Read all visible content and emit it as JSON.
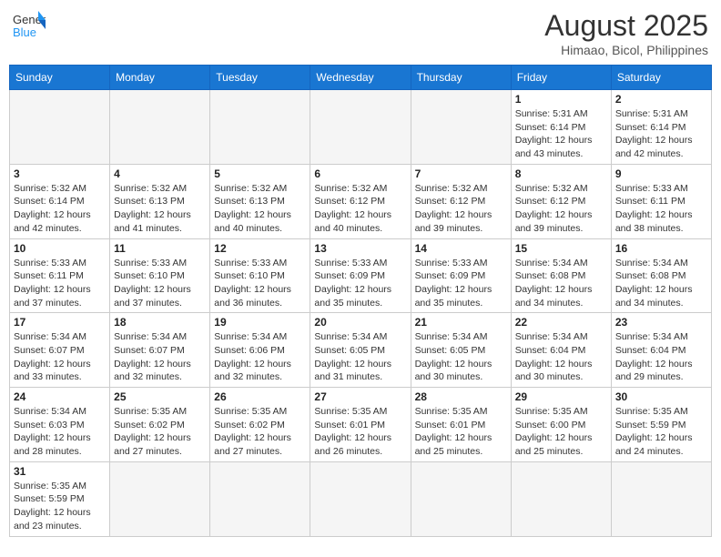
{
  "header": {
    "logo_general": "General",
    "logo_blue": "Blue",
    "month_year": "August 2025",
    "location": "Himaao, Bicol, Philippines"
  },
  "weekdays": [
    "Sunday",
    "Monday",
    "Tuesday",
    "Wednesday",
    "Thursday",
    "Friday",
    "Saturday"
  ],
  "weeks": [
    [
      {
        "day": "",
        "info": ""
      },
      {
        "day": "",
        "info": ""
      },
      {
        "day": "",
        "info": ""
      },
      {
        "day": "",
        "info": ""
      },
      {
        "day": "",
        "info": ""
      },
      {
        "day": "1",
        "info": "Sunrise: 5:31 AM\nSunset: 6:14 PM\nDaylight: 12 hours and 43 minutes."
      },
      {
        "day": "2",
        "info": "Sunrise: 5:31 AM\nSunset: 6:14 PM\nDaylight: 12 hours and 42 minutes."
      }
    ],
    [
      {
        "day": "3",
        "info": "Sunrise: 5:32 AM\nSunset: 6:14 PM\nDaylight: 12 hours and 42 minutes."
      },
      {
        "day": "4",
        "info": "Sunrise: 5:32 AM\nSunset: 6:13 PM\nDaylight: 12 hours and 41 minutes."
      },
      {
        "day": "5",
        "info": "Sunrise: 5:32 AM\nSunset: 6:13 PM\nDaylight: 12 hours and 40 minutes."
      },
      {
        "day": "6",
        "info": "Sunrise: 5:32 AM\nSunset: 6:12 PM\nDaylight: 12 hours and 40 minutes."
      },
      {
        "day": "7",
        "info": "Sunrise: 5:32 AM\nSunset: 6:12 PM\nDaylight: 12 hours and 39 minutes."
      },
      {
        "day": "8",
        "info": "Sunrise: 5:32 AM\nSunset: 6:12 PM\nDaylight: 12 hours and 39 minutes."
      },
      {
        "day": "9",
        "info": "Sunrise: 5:33 AM\nSunset: 6:11 PM\nDaylight: 12 hours and 38 minutes."
      }
    ],
    [
      {
        "day": "10",
        "info": "Sunrise: 5:33 AM\nSunset: 6:11 PM\nDaylight: 12 hours and 37 minutes."
      },
      {
        "day": "11",
        "info": "Sunrise: 5:33 AM\nSunset: 6:10 PM\nDaylight: 12 hours and 37 minutes."
      },
      {
        "day": "12",
        "info": "Sunrise: 5:33 AM\nSunset: 6:10 PM\nDaylight: 12 hours and 36 minutes."
      },
      {
        "day": "13",
        "info": "Sunrise: 5:33 AM\nSunset: 6:09 PM\nDaylight: 12 hours and 35 minutes."
      },
      {
        "day": "14",
        "info": "Sunrise: 5:33 AM\nSunset: 6:09 PM\nDaylight: 12 hours and 35 minutes."
      },
      {
        "day": "15",
        "info": "Sunrise: 5:34 AM\nSunset: 6:08 PM\nDaylight: 12 hours and 34 minutes."
      },
      {
        "day": "16",
        "info": "Sunrise: 5:34 AM\nSunset: 6:08 PM\nDaylight: 12 hours and 34 minutes."
      }
    ],
    [
      {
        "day": "17",
        "info": "Sunrise: 5:34 AM\nSunset: 6:07 PM\nDaylight: 12 hours and 33 minutes."
      },
      {
        "day": "18",
        "info": "Sunrise: 5:34 AM\nSunset: 6:07 PM\nDaylight: 12 hours and 32 minutes."
      },
      {
        "day": "19",
        "info": "Sunrise: 5:34 AM\nSunset: 6:06 PM\nDaylight: 12 hours and 32 minutes."
      },
      {
        "day": "20",
        "info": "Sunrise: 5:34 AM\nSunset: 6:05 PM\nDaylight: 12 hours and 31 minutes."
      },
      {
        "day": "21",
        "info": "Sunrise: 5:34 AM\nSunset: 6:05 PM\nDaylight: 12 hours and 30 minutes."
      },
      {
        "day": "22",
        "info": "Sunrise: 5:34 AM\nSunset: 6:04 PM\nDaylight: 12 hours and 30 minutes."
      },
      {
        "day": "23",
        "info": "Sunrise: 5:34 AM\nSunset: 6:04 PM\nDaylight: 12 hours and 29 minutes."
      }
    ],
    [
      {
        "day": "24",
        "info": "Sunrise: 5:34 AM\nSunset: 6:03 PM\nDaylight: 12 hours and 28 minutes."
      },
      {
        "day": "25",
        "info": "Sunrise: 5:35 AM\nSunset: 6:02 PM\nDaylight: 12 hours and 27 minutes."
      },
      {
        "day": "26",
        "info": "Sunrise: 5:35 AM\nSunset: 6:02 PM\nDaylight: 12 hours and 27 minutes."
      },
      {
        "day": "27",
        "info": "Sunrise: 5:35 AM\nSunset: 6:01 PM\nDaylight: 12 hours and 26 minutes."
      },
      {
        "day": "28",
        "info": "Sunrise: 5:35 AM\nSunset: 6:01 PM\nDaylight: 12 hours and 25 minutes."
      },
      {
        "day": "29",
        "info": "Sunrise: 5:35 AM\nSunset: 6:00 PM\nDaylight: 12 hours and 25 minutes."
      },
      {
        "day": "30",
        "info": "Sunrise: 5:35 AM\nSunset: 5:59 PM\nDaylight: 12 hours and 24 minutes."
      }
    ],
    [
      {
        "day": "31",
        "info": "Sunrise: 5:35 AM\nSunset: 5:59 PM\nDaylight: 12 hours and 23 minutes."
      },
      {
        "day": "",
        "info": ""
      },
      {
        "day": "",
        "info": ""
      },
      {
        "day": "",
        "info": ""
      },
      {
        "day": "",
        "info": ""
      },
      {
        "day": "",
        "info": ""
      },
      {
        "day": "",
        "info": ""
      }
    ]
  ]
}
